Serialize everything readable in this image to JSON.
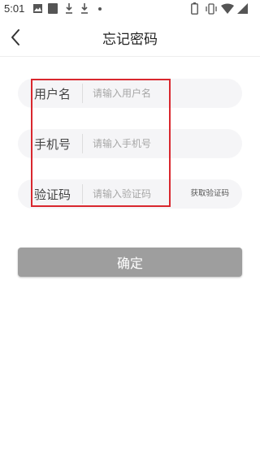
{
  "status_bar": {
    "time": "5:01",
    "icons": [
      "image-icon",
      "square-icon",
      "download-icon",
      "download-icon",
      "dot-icon",
      "battery-icon",
      "vibrate-icon",
      "wifi-icon",
      "signal-icon"
    ]
  },
  "header": {
    "title": "忘记密码",
    "back_icon": "chevron-left-icon"
  },
  "form": {
    "username": {
      "label": "用户名",
      "placeholder": "请输入用户名",
      "value": ""
    },
    "phone": {
      "label": "手机号",
      "placeholder": "请输入手机号",
      "value": ""
    },
    "code": {
      "label": "验证码",
      "placeholder": "请输入验证码",
      "value": "",
      "button_label": "获取验证码"
    }
  },
  "confirm_label": "确定",
  "colors": {
    "highlight": "#d9272e",
    "confirm_bg": "#9e9e9e",
    "field_bg": "#f5f5f7"
  }
}
